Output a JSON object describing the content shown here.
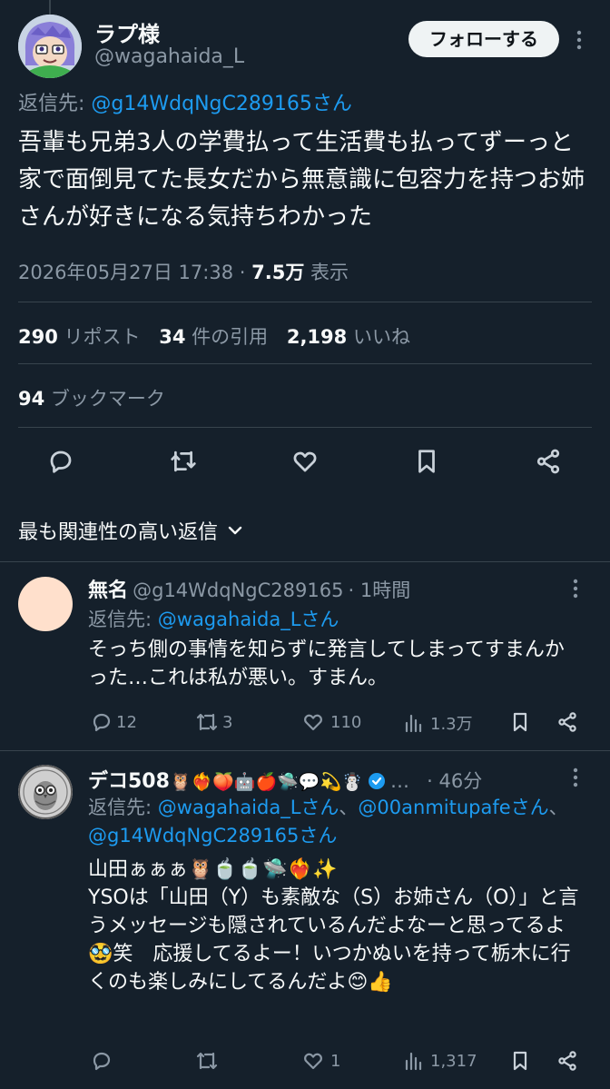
{
  "tweet": {
    "author_name": "ラプ様",
    "handle": "@wagahaida_L",
    "follow_label": "フォローする",
    "reply_prefix": "返信先:",
    "reply_to": "@g14WdqNgC289165さん",
    "text": "吾輩も兄弟3人の学費払って生活費も払ってずーっと家で面倒見てた長女だから無意識に包容力を持つお姉さんが好きになる気持ちわかった",
    "timestamp": "2026年05月27日 17:38",
    "dot": "·",
    "views_count": "7.5万",
    "views_label": "表示",
    "reposts_count": "290",
    "reposts_label": "リポスト",
    "quotes_count": "34",
    "quotes_label": "件の引用",
    "likes_count": "2,198",
    "likes_label": "いいね",
    "bookmarks_count": "94",
    "bookmarks_label": "ブックマーク"
  },
  "sort": {
    "label": "最も関連性の高い返信"
  },
  "replies": [
    {
      "name": "無名",
      "handle": "@g14WdqNgC289165",
      "time": "· 1時間",
      "reply_prefix": "返信先:",
      "reply_to": "@wagahaida_Lさん",
      "text": "そっち側の事情を知らずに発言してしまってすまんかった…これは私が悪い。すまん。",
      "replies": "12",
      "reposts": "3",
      "likes": "110",
      "views": "1.3万",
      "avatar_color": "#ffe0cc"
    },
    {
      "name": "デコ508",
      "name_emoji": "🦉❤️‍🔥🍑🤖🍎🛸💬💫☃️",
      "ellipsis": "…",
      "time": "· 46分",
      "reply_prefix": "返信先:",
      "reply_to_1": "@wagahaida_Lさん",
      "reply_sep": "、",
      "reply_to_2": "@00anmitupafeさん",
      "reply_to_3": "@g14WdqNgC289165さん",
      "text_line1": "山田ぁぁぁ🦉🍵🍵🛸❤️‍🔥✨",
      "text_body": "YSOは「山田（Y）も素敵な（S）お姉さん（O）」と言うメッセージも隠されているんだよなーと思ってるよ🥸笑　応援してるよー！いつかぬいを持って栃木に行くのも楽しみにしてるんだよ😊👍",
      "replies": "",
      "reposts": "",
      "likes": "1",
      "views": "1,317"
    }
  ],
  "colors": {
    "background": "#15202b",
    "text": "#f7f9f9",
    "secondary": "#8b98a5",
    "link": "#1d9bf0",
    "divider": "#38444d",
    "verified": "#1d9bf0"
  }
}
